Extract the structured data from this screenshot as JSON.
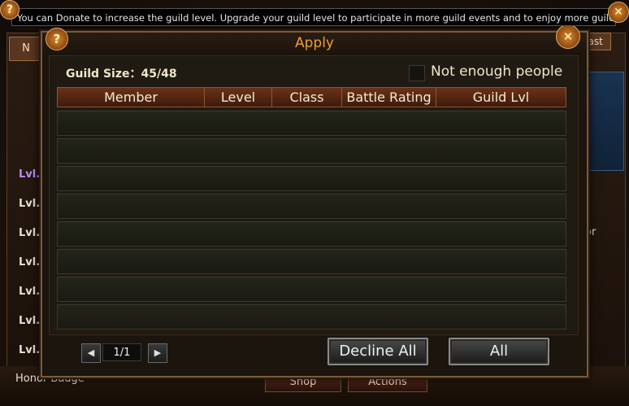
{
  "tooltip": {
    "text": "You can Donate to increase the guild level. Upgrade your guild level to participate in more guild events and to enjoy more guild benefits."
  },
  "background": {
    "tab_n": "N",
    "tab_east": "east",
    "lvl_items": [
      "Lvl.",
      "Lvl.",
      "Lvl.",
      "Lvl.",
      "Lvl.",
      "Lvl.",
      "Lvl."
    ],
    "honor_label": "Honor Badge",
    "shop_label": "Shop",
    "actions_label": "Actions",
    "right_text": "or"
  },
  "dialog": {
    "title": "Apply",
    "help_icon": "?",
    "close_icon": "✕",
    "guild_size_label": "Guild Size：45/48",
    "not_enough_label": "Not enough people",
    "columns": [
      "Member",
      "Level",
      "Class",
      "Battle Rating",
      "Guild Lvl"
    ],
    "row_count": 8,
    "pagination": {
      "page": "1/1",
      "prev_icon": "◀",
      "next_icon": "▶"
    },
    "decline_all_label": "Decline All",
    "accept_all_label": "All"
  }
}
